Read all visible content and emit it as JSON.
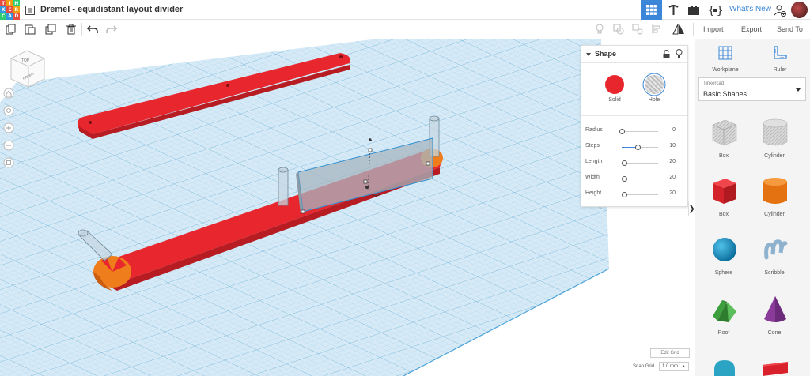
{
  "app": {
    "logo_letters": [
      "T",
      "I",
      "N",
      "K",
      "E",
      "R",
      "C",
      "A",
      "D"
    ],
    "title": "Dremel - equidistant layout divider",
    "whats_new": "What's New"
  },
  "toolbar": {
    "import_label": "Import",
    "export_label": "Export",
    "send_to_label": "Send To"
  },
  "viewcube": {
    "top_label": "TOP",
    "front_label": "FRONT"
  },
  "inspector": {
    "title": "Shape",
    "solid_label": "Solid",
    "hole_label": "Hole",
    "properties": [
      {
        "label": "Radius",
        "value": "0",
        "fraction": 0.0
      },
      {
        "label": "Steps",
        "value": "10",
        "fraction": 0.45
      },
      {
        "label": "Length",
        "value": "20",
        "fraction": 0.08
      },
      {
        "label": "Width",
        "value": "20",
        "fraction": 0.08
      },
      {
        "label": "Height",
        "value": "20",
        "fraction": 0.08
      }
    ]
  },
  "sidebar": {
    "workplane_label": "Workplane",
    "ruler_label": "Ruler",
    "library_small": "Tinkercad",
    "library_value": "Basic Shapes",
    "items": [
      {
        "label": "Box"
      },
      {
        "label": "Cylinder"
      },
      {
        "label": "Box"
      },
      {
        "label": "Cylinder"
      },
      {
        "label": "Sphere"
      },
      {
        "label": "Scribble"
      },
      {
        "label": "Roof"
      },
      {
        "label": "Cone"
      }
    ]
  },
  "grid": {
    "edit_grid_label": "Edit Grid",
    "snap_grid_label": "Snap Grid",
    "snap_value": "1.0 mm"
  },
  "colors": {
    "accent": "#3b86d8",
    "solid_red": "#e8262d",
    "orange": "#f07d1c",
    "workplane": "#cfe6f3"
  }
}
